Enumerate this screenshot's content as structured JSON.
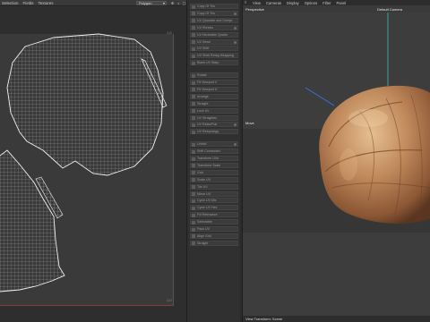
{
  "uv_editor": {
    "menu": [
      "Selection",
      "Fields",
      "Textures"
    ],
    "mode_value": "Polygon",
    "corners": {
      "top_right": "1,0",
      "bottom_right": "1,0"
    },
    "colors": {
      "mesh": "#e8e8e8",
      "edge": "#8a3a3a"
    }
  },
  "middle_panel": {
    "rows": [
      {
        "label": "Copy Of Tris"
      },
      {
        "label": "Copy Of Tris"
      },
      {
        "label": "UV Quantize and Compr."
      },
      {
        "label": "UV Shrinks"
      },
      {
        "label": "UV Neutralize Quads"
      },
      {
        "label": "UV Sewn"
      },
      {
        "label": "UV Shift"
      },
      {
        "label": "UV Shell Retag Wrapping"
      },
      {
        "label": "Blank UV Warp"
      },
      {
        "label": "Rotate"
      },
      {
        "label": "Fit Viewport V"
      },
      {
        "label": "Fit Viewport U"
      },
      {
        "label": "Arrange"
      },
      {
        "label": "Straight"
      },
      {
        "label": "Lock UV"
      },
      {
        "label": "UV Straighten"
      },
      {
        "label": "UV Relax/Flat"
      },
      {
        "label": "UV Retopology"
      },
      {
        "label": "Unfold"
      },
      {
        "label": "Shift Connected"
      },
      {
        "label": "Transform UVs"
      },
      {
        "label": "Transform Scale"
      },
      {
        "label": "Grid"
      },
      {
        "label": "Scale UV"
      },
      {
        "label": "Tile UV"
      },
      {
        "label": "Mirror UV"
      },
      {
        "label": "Cycle UV Mix"
      },
      {
        "label": "Cycle UV Hex"
      },
      {
        "label": "Fill Relevance"
      },
      {
        "label": "Selectable"
      },
      {
        "label": "Pack UV"
      },
      {
        "label": "Align Grid"
      },
      {
        "label": "Straight"
      }
    ]
  },
  "viewport": {
    "menu": [
      "View",
      "Cameras",
      "Display",
      "Options",
      "Filter",
      "Panel"
    ],
    "camera_name": "Perspective",
    "default_camera": "Default Camera",
    "object_label": "Move",
    "status": "View Transform: Scene",
    "colors": {
      "shell_dark": "#7a4a2a",
      "shell_mid": "#b98356",
      "shell_light": "#e2b98b",
      "axis": "#3fbfb0",
      "handle": "#3f6fe0"
    }
  }
}
